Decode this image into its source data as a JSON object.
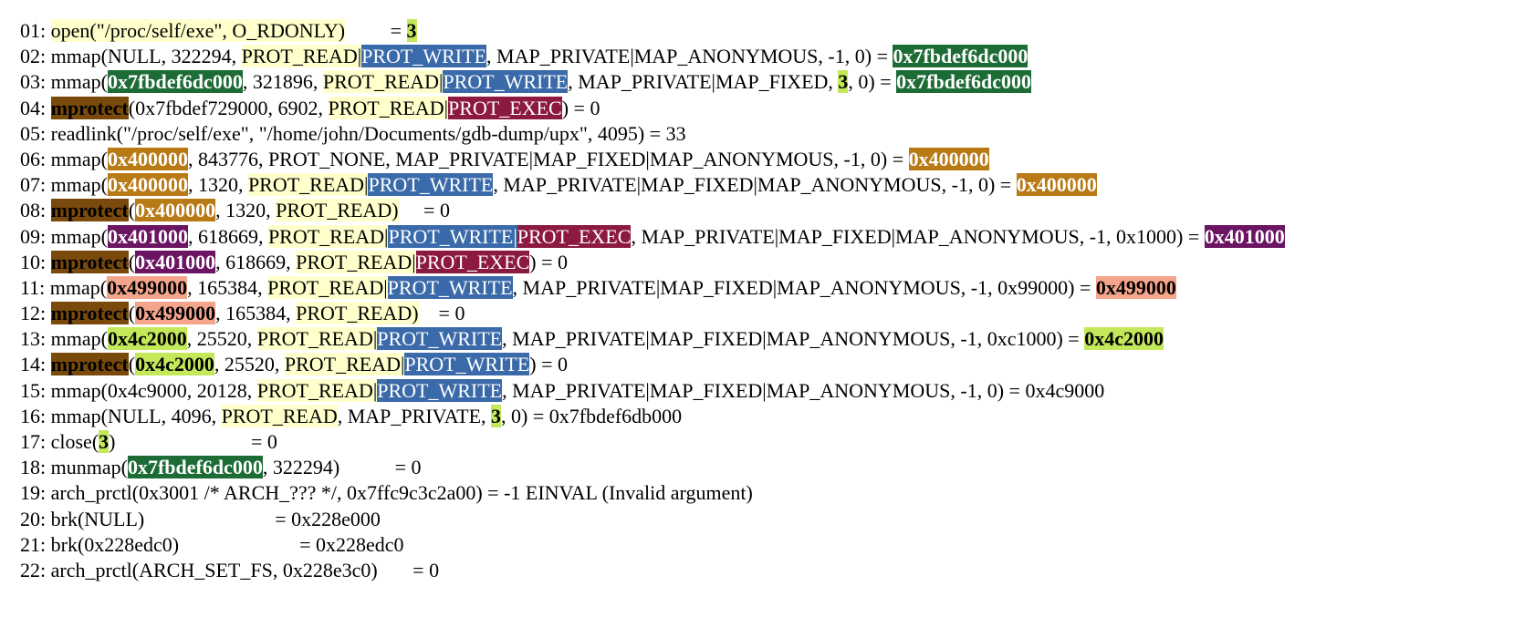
{
  "lines": [
    [
      {
        "t": "01: "
      },
      {
        "t": "open(\"/proc/self/exe\", O_RDONLY)",
        "h": "yellow"
      },
      {
        "t": "         = "
      },
      {
        "t": "3",
        "h": "lime"
      }
    ],
    [
      {
        "t": "02: mmap(NULL, 322294, "
      },
      {
        "t": "PROT_READ|",
        "h": "yellow"
      },
      {
        "t": "PROT_WRITE",
        "h": "blue"
      },
      {
        "t": ", MAP_PRIVATE|MAP_ANONYMOUS, -1, 0) = "
      },
      {
        "t": "0x7fbdef6dc000",
        "h": "green"
      }
    ],
    [
      {
        "t": "03: mmap("
      },
      {
        "t": "0x7fbdef6dc000",
        "h": "green"
      },
      {
        "t": ", 321896, "
      },
      {
        "t": "PROT_READ|",
        "h": "yellow"
      },
      {
        "t": "PROT_WRITE",
        "h": "blue"
      },
      {
        "t": ", MAP_PRIVATE|MAP_FIXED, "
      },
      {
        "t": "3",
        "h": "lime"
      },
      {
        "t": ", 0) = "
      },
      {
        "t": "0x7fbdef6dc000",
        "h": "green"
      }
    ],
    [
      {
        "t": "04: "
      },
      {
        "t": "mprotect",
        "h": "brown"
      },
      {
        "t": "(0x7fbdef729000, 6902, "
      },
      {
        "t": "PROT_READ|",
        "h": "yellow"
      },
      {
        "t": "PROT_EXEC",
        "h": "maroon"
      },
      {
        "t": ") = 0"
      }
    ],
    [
      {
        "t": "05: readlink(\"/proc/self/exe\", \"/home/john/Documents/gdb-dump/upx\", 4095) = 33"
      }
    ],
    [
      {
        "t": "06: mmap("
      },
      {
        "t": "0x400000",
        "h": "orange"
      },
      {
        "t": ", 843776, PROT_NONE, MAP_PRIVATE|MAP_FIXED|MAP_ANONYMOUS, -1, 0) = "
      },
      {
        "t": "0x400000",
        "h": "orange"
      }
    ],
    [
      {
        "t": "07: mmap("
      },
      {
        "t": "0x400000",
        "h": "orange"
      },
      {
        "t": ", 1320, "
      },
      {
        "t": "PROT_READ|",
        "h": "yellow"
      },
      {
        "t": "PROT_WRITE",
        "h": "blue"
      },
      {
        "t": ", MAP_PRIVATE|MAP_FIXED|MAP_ANONYMOUS, -1, 0) = "
      },
      {
        "t": "0x400000",
        "h": "orange"
      }
    ],
    [
      {
        "t": "08: "
      },
      {
        "t": "mprotect",
        "h": "brown"
      },
      {
        "t": "("
      },
      {
        "t": "0x400000",
        "h": "orange"
      },
      {
        "t": ", 1320, "
      },
      {
        "t": "PROT_READ)",
        "h": "yellow"
      },
      {
        "t": "     = 0"
      }
    ],
    [
      {
        "t": "09: mmap("
      },
      {
        "t": "0x401000",
        "h": "purple"
      },
      {
        "t": ", 618669, "
      },
      {
        "t": "PROT_READ|",
        "h": "yellow"
      },
      {
        "t": "PROT_WRITE|",
        "h": "blue"
      },
      {
        "t": "PROT_EXEC",
        "h": "maroon"
      },
      {
        "t": ", MAP_PRIVATE|MAP_FIXED|MAP_ANONYMOUS, -1, 0x1000) = "
      },
      {
        "t": "0x401000",
        "h": "purple"
      }
    ],
    [
      {
        "t": "10: "
      },
      {
        "t": "mprotect",
        "h": "brown"
      },
      {
        "t": "("
      },
      {
        "t": "0x401000",
        "h": "purple"
      },
      {
        "t": ", 618669, "
      },
      {
        "t": "PROT_READ|",
        "h": "yellow"
      },
      {
        "t": "PROT_EXEC",
        "h": "maroon"
      },
      {
        "t": ") = 0"
      }
    ],
    [
      {
        "t": "11: mmap("
      },
      {
        "t": "0x499000",
        "h": "salmon"
      },
      {
        "t": ", 165384, "
      },
      {
        "t": "PROT_READ|",
        "h": "yellow"
      },
      {
        "t": "PROT_WRITE",
        "h": "blue"
      },
      {
        "t": ", MAP_PRIVATE|MAP_FIXED|MAP_ANONYMOUS, -1, 0x99000) = "
      },
      {
        "t": "0x499000",
        "h": "salmon"
      }
    ],
    [
      {
        "t": "12: "
      },
      {
        "t": "mprotect",
        "h": "brown"
      },
      {
        "t": "("
      },
      {
        "t": "0x499000",
        "h": "salmon"
      },
      {
        "t": ", 165384, "
      },
      {
        "t": "PROT_READ)",
        "h": "yellow"
      },
      {
        "t": "    = 0"
      }
    ],
    [
      {
        "t": "13: mmap("
      },
      {
        "t": "0x4c2000",
        "h": "olive"
      },
      {
        "t": ", 25520, "
      },
      {
        "t": "PROT_READ|",
        "h": "yellow"
      },
      {
        "t": "PROT_WRITE",
        "h": "blue"
      },
      {
        "t": ", MAP_PRIVATE|MAP_FIXED|MAP_ANONYMOUS, -1, 0xc1000) = "
      },
      {
        "t": "0x4c2000",
        "h": "olive"
      }
    ],
    [
      {
        "t": "14: "
      },
      {
        "t": "mprotect",
        "h": "brown"
      },
      {
        "t": "("
      },
      {
        "t": "0x4c2000",
        "h": "olive"
      },
      {
        "t": ", 25520, "
      },
      {
        "t": "PROT_READ|",
        "h": "yellow"
      },
      {
        "t": "PROT_WRITE",
        "h": "blue"
      },
      {
        "t": ") = 0"
      }
    ],
    [
      {
        "t": "15: mmap(0x4c9000, 20128, "
      },
      {
        "t": "PROT_READ|",
        "h": "yellow"
      },
      {
        "t": "PROT_WRITE",
        "h": "blue"
      },
      {
        "t": ", MAP_PRIVATE|MAP_FIXED|MAP_ANONYMOUS, -1, 0) = 0x4c9000"
      }
    ],
    [
      {
        "t": "16: mmap(NULL, 4096, "
      },
      {
        "t": "PROT_READ",
        "h": "yellow"
      },
      {
        "t": ", MAP_PRIVATE, "
      },
      {
        "t": "3",
        "h": "lime"
      },
      {
        "t": ", 0) = 0x7fbdef6db000"
      }
    ],
    [
      {
        "t": "17: close("
      },
      {
        "t": "3",
        "h": "lime"
      },
      {
        "t": ")                           = 0"
      }
    ],
    [
      {
        "t": "18: munmap("
      },
      {
        "t": "0x7fbdef6dc000",
        "h": "green"
      },
      {
        "t": ", 322294)           = 0"
      }
    ],
    [
      {
        "t": "19: arch_prctl(0x3001 /* ARCH_??? */, 0x7ffc9c3c2a00) = -1 EINVAL (Invalid argument)"
      }
    ],
    [
      {
        "t": "20: brk(NULL)                          = 0x228e000"
      }
    ],
    [
      {
        "t": "21: brk(0x228edc0)                        = 0x228edc0"
      }
    ],
    [
      {
        "t": "22: arch_prctl(ARCH_SET_FS, 0x228e3c0)       = 0"
      }
    ]
  ]
}
